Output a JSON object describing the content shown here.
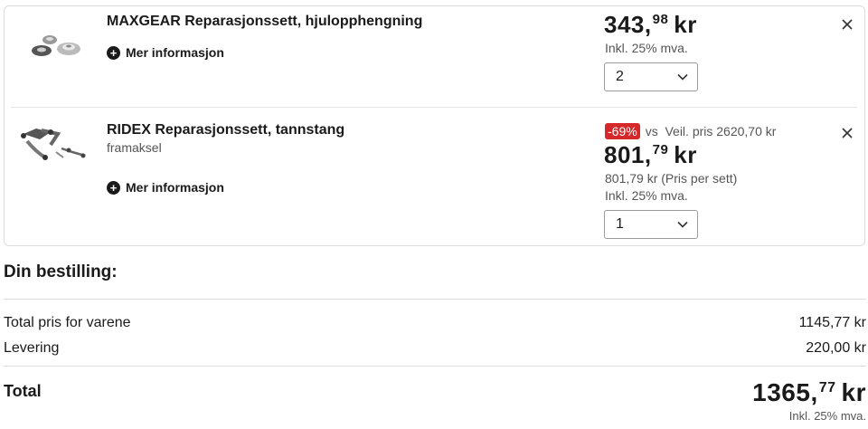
{
  "items": [
    {
      "title": "MAXGEAR Reparasjonssett, hjulopphengning",
      "more_label": "Mer informasjon",
      "price_whole": "343,",
      "price_cents": "98",
      "currency": "kr",
      "vat": "Inkl. 25% mva.",
      "quantity": "2",
      "image_icon": "strut-mount-kit-icon"
    },
    {
      "title": "RIDEX Reparasjonssett, tannstang",
      "subtitle": "framaksel",
      "more_label": "Mer informasjon",
      "discount_badge": "-69%",
      "discount_text": "vs  Veil. pris 2620,70 kr",
      "price_whole": "801,",
      "price_cents": "79",
      "currency": "kr",
      "per_set": "801,79 kr (Pris per sett)",
      "vat": "Inkl. 25% mva.",
      "quantity": "1",
      "image_icon": "control-arm-kit-icon"
    }
  ],
  "summary": {
    "title": "Din bestilling:",
    "rows": [
      {
        "label": "Total pris for varene",
        "value": "1145,77 kr"
      },
      {
        "label": "Levering",
        "value": "220,00 kr"
      }
    ],
    "total_label": "Total",
    "total_whole": "1365,",
    "total_cents": "77",
    "total_currency": "kr",
    "total_vat": "Inkl. 25% mva."
  },
  "colors": {
    "discount_badge": "#d6282a",
    "border": "#dcdcdc"
  }
}
